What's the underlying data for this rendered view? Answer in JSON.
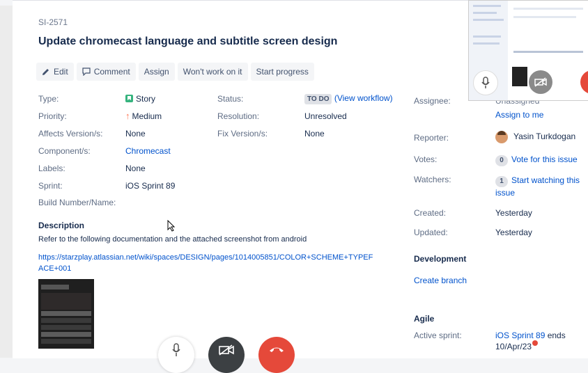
{
  "issue": {
    "key": "SI-2571",
    "title": "Update chromecast language and subtitle screen design"
  },
  "toolbar": {
    "edit": "Edit",
    "comment": "Comment",
    "assign": "Assign",
    "wont_work": "Won't work on it",
    "start_progress": "Start progress"
  },
  "details": {
    "type_label": "Type:",
    "type_value": "Story",
    "priority_label": "Priority:",
    "priority_value": "Medium",
    "affects_label": "Affects Version/s:",
    "affects_value": "None",
    "components_label": "Component/s:",
    "components_value": "Chromecast",
    "labels_label": "Labels:",
    "labels_value": "None",
    "sprint_label": "Sprint:",
    "sprint_value": "iOS Sprint 89",
    "build_label": "Build Number/Name:",
    "status_label": "Status:",
    "status_value": "TO DO",
    "view_workflow": "(View workflow)",
    "resolution_label": "Resolution:",
    "resolution_value": "Unresolved",
    "fix_label": "Fix Version/s:",
    "fix_value": "None"
  },
  "description": {
    "heading": "Description",
    "text": "Refer to the following documentation and the attached screenshot from android",
    "link": "https://starzplay.atlassian.net/wiki/spaces/DESIGN/pages/1014005851/COLOR+SCHEME+TYPEFACE+001"
  },
  "people": {
    "assignee_label": "Assignee:",
    "assignee_value": "Unassigned",
    "assign_to_me": "Assign to me",
    "reporter_label": "Reporter:",
    "reporter_value": "Yasin Turkdogan",
    "votes_label": "Votes:",
    "votes_count": "0",
    "vote_link": "Vote for this issue",
    "watchers_label": "Watchers:",
    "watchers_count": "1",
    "watch_link": "Start watching this issue"
  },
  "dates": {
    "created_label": "Created:",
    "created_value": "Yesterday",
    "updated_label": "Updated:",
    "updated_value": "Yesterday"
  },
  "development": {
    "heading": "Development",
    "create_branch": "Create branch"
  },
  "agile": {
    "heading": "Agile",
    "active_sprint_label": "Active sprint:",
    "sprint_link": "iOS Sprint 89",
    "ends_text": " ends",
    "end_date": "10/Apr/23"
  },
  "colors": {
    "link": "#0052cc",
    "story": "#36b37e",
    "priority": "#ff7452",
    "call_end": "#e5493a",
    "call_dark": "#3c4043"
  },
  "icons": [
    "pencil-icon",
    "comment-icon",
    "story-icon",
    "priority-medium-icon",
    "mic-icon",
    "camera-off-icon",
    "hangup-icon",
    "cursor-icon"
  ]
}
